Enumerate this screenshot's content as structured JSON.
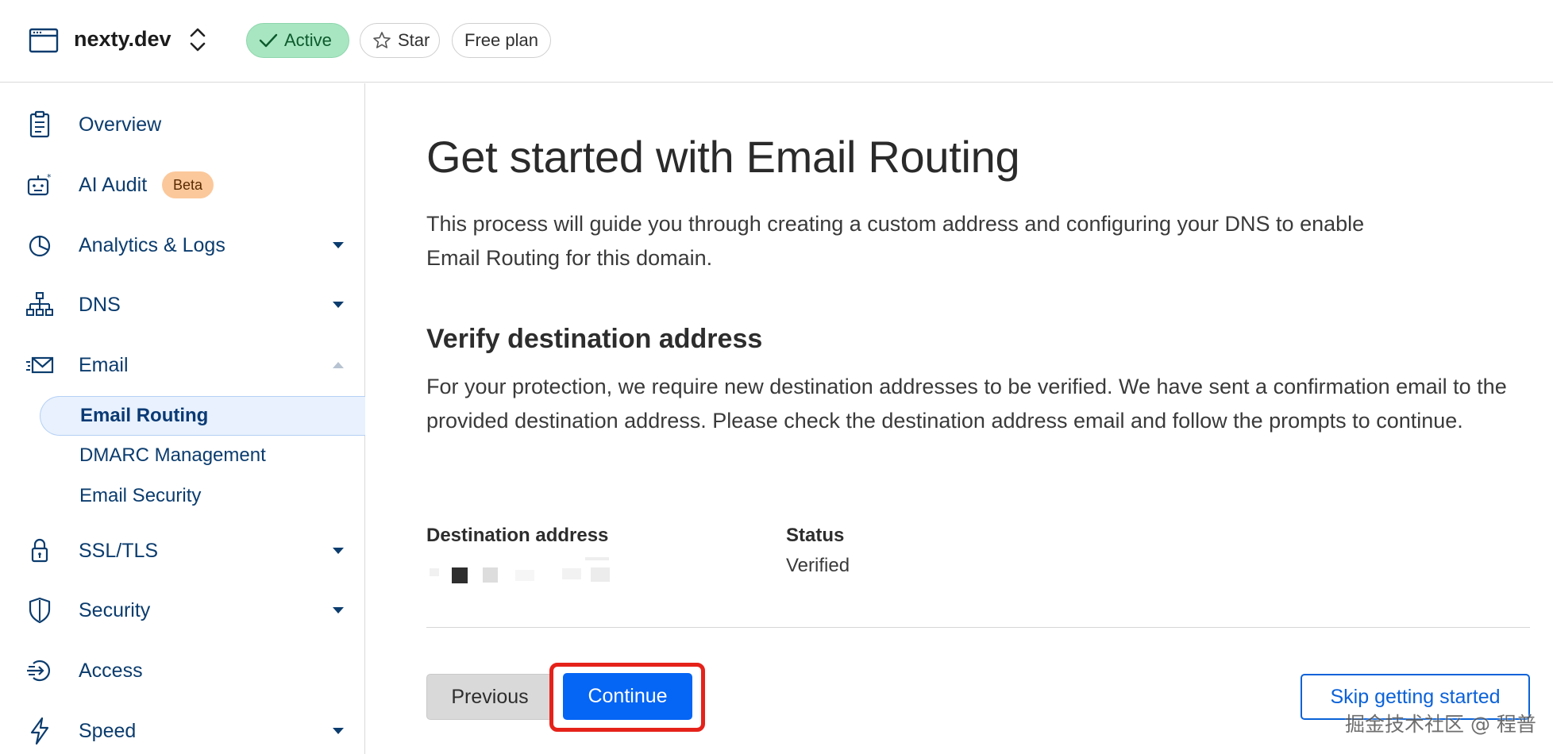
{
  "header": {
    "site_name": "nexty.dev",
    "status_badge": "Active",
    "star_label": "Star",
    "plan_label": "Free plan"
  },
  "sidebar": {
    "items": [
      {
        "label": "Overview",
        "icon": "clipboard-icon"
      },
      {
        "label": "AI Audit",
        "icon": "robot-icon",
        "badge": "Beta"
      },
      {
        "label": "Analytics & Logs",
        "icon": "pie-chart-icon",
        "expandable": true
      },
      {
        "label": "DNS",
        "icon": "network-tree-icon",
        "expandable": true
      },
      {
        "label": "Email",
        "icon": "envelope-icon",
        "expanded": true
      },
      {
        "label": "SSL/TLS",
        "icon": "lock-icon",
        "expandable": true
      },
      {
        "label": "Security",
        "icon": "shield-icon",
        "expandable": true
      },
      {
        "label": "Access",
        "icon": "access-icon"
      },
      {
        "label": "Speed",
        "icon": "lightning-icon",
        "expandable": true
      }
    ],
    "email_subitems": [
      {
        "label": "Email Routing",
        "active": true
      },
      {
        "label": "DMARC Management"
      },
      {
        "label": "Email Security"
      }
    ]
  },
  "main": {
    "title": "Get started with Email Routing",
    "intro": "This process will guide you through creating a custom address and configuring your DNS to enable Email Routing for this domain.",
    "section_title": "Verify destination address",
    "section_body": "For your protection, we require new destination addresses to be verified. We have sent a confirmation email to the provided destination address. Please check the destination address email and follow the prompts to continue.",
    "table": {
      "columns": [
        "Destination address",
        "Status"
      ],
      "status_value": "Verified"
    },
    "buttons": {
      "previous": "Previous",
      "continue": "Continue",
      "skip": "Skip getting started"
    }
  },
  "watermark": "掘金技术社区 @ 程普",
  "colors": {
    "primary": "#0565f5",
    "nav_text": "#0b3c6e",
    "active_badge_bg": "#a8e6c1",
    "beta_badge_bg": "#fbc89b",
    "highlight": "#e5221a"
  }
}
